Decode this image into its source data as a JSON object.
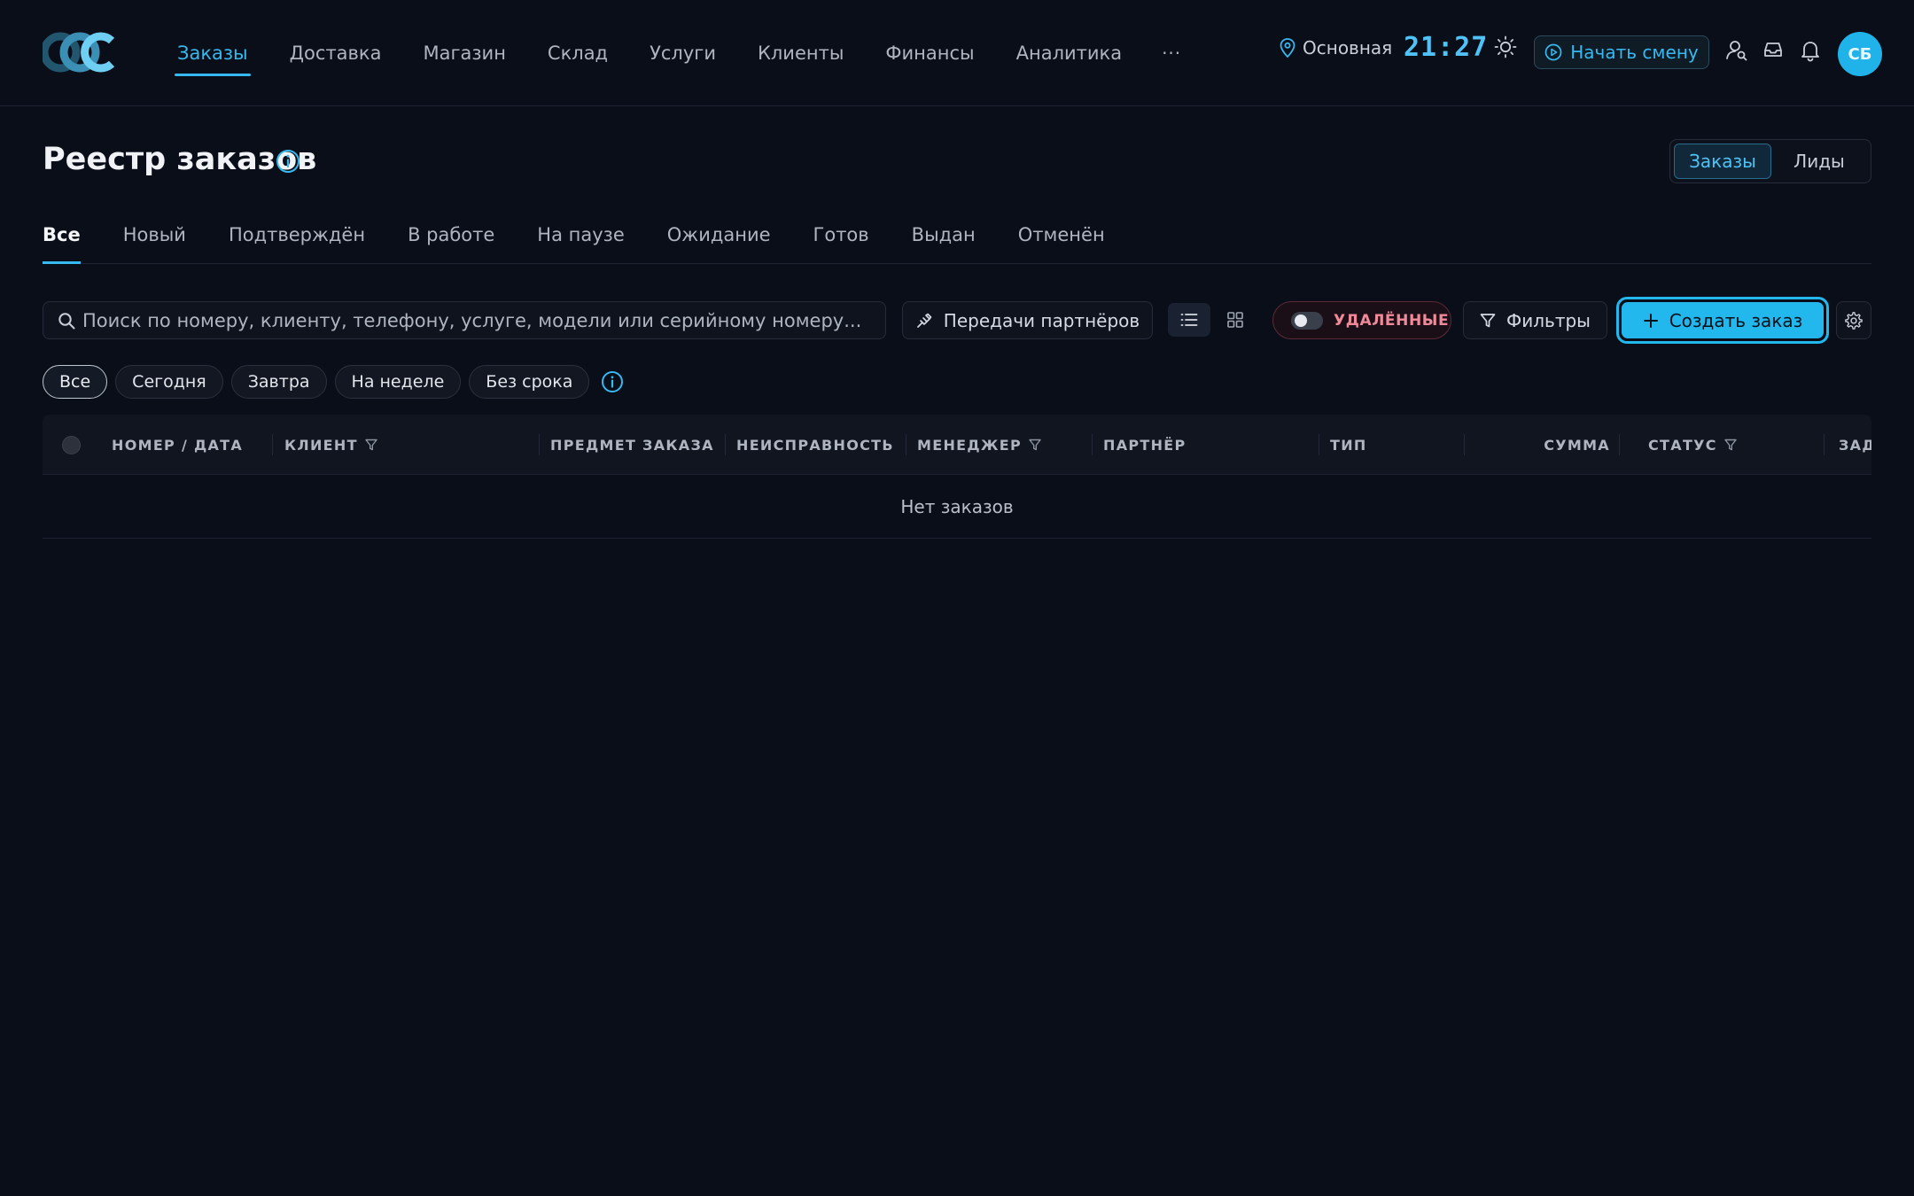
{
  "nav": {
    "items": [
      {
        "label": "Заказы",
        "active": true
      },
      {
        "label": "Доставка"
      },
      {
        "label": "Магазин"
      },
      {
        "label": "Склад"
      },
      {
        "label": "Услуги"
      },
      {
        "label": "Клиенты"
      },
      {
        "label": "Финансы"
      },
      {
        "label": "Аналитика"
      }
    ],
    "more": "···"
  },
  "topbar": {
    "branch": "Основная",
    "clock": "21:27",
    "shift_button": "Начать смену",
    "avatar_initials": "СБ"
  },
  "header": {
    "title": "Реестр заказов",
    "segments": [
      {
        "label": "Заказы",
        "active": true
      },
      {
        "label": "Лиды"
      }
    ]
  },
  "tabs": [
    {
      "label": "Все",
      "active": true
    },
    {
      "label": "Новый"
    },
    {
      "label": "Подтверждён"
    },
    {
      "label": "В работе"
    },
    {
      "label": "На паузе"
    },
    {
      "label": "Ожидание"
    },
    {
      "label": "Готов"
    },
    {
      "label": "Выдан"
    },
    {
      "label": "Отменён"
    }
  ],
  "toolbar": {
    "search_placeholder": "Поиск по номеру, клиенту, телефону, услуге, модели или серийному номеру...",
    "partner_transfers": "Передачи партнёров",
    "deleted_label": "УДАЛЁННЫЕ",
    "filters": "Фильтры",
    "create_order": "Создать заказ"
  },
  "date_chips": [
    {
      "label": "Все",
      "active": true
    },
    {
      "label": "Сегодня"
    },
    {
      "label": "Завтра"
    },
    {
      "label": "На неделе"
    },
    {
      "label": "Без срока"
    }
  ],
  "table": {
    "columns": [
      {
        "label": "НОМЕР / ДАТА"
      },
      {
        "label": "КЛИЕНТ",
        "filter": true
      },
      {
        "label": "ПРЕДМЕТ ЗАКАЗА"
      },
      {
        "label": "НЕИСПРАВНОСТЬ"
      },
      {
        "label": "МЕНЕДЖЕР",
        "filter": true
      },
      {
        "label": "ПАРТНЁР"
      },
      {
        "label": "ТИП"
      },
      {
        "label": "СУММА"
      },
      {
        "label": "СТАТУС",
        "filter": true
      },
      {
        "label": "ЗАД"
      }
    ],
    "empty_text": "Нет заказов"
  },
  "colors": {
    "background": "#0a0e18",
    "accent": "#22b8ee",
    "danger_text": "#f08a9b"
  }
}
